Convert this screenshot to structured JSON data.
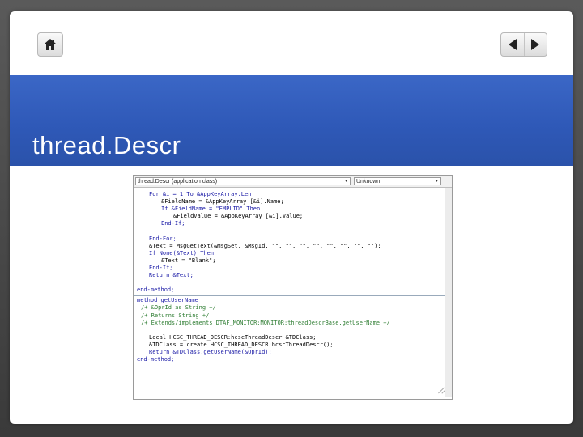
{
  "slide": {
    "title": "thread.Descr"
  },
  "icons": {
    "home": "home-icon",
    "prev": "triangle-left-icon",
    "next": "triangle-right-icon"
  },
  "colors": {
    "title_band": "#2f59b8",
    "title_text": "#ffffff",
    "keyword": "#1a1aa6",
    "comment": "#2e7d32",
    "string": "#b00020"
  },
  "code_editor": {
    "object_selector": "thread.Descr (application class)",
    "event_selector": "Unknown",
    "lines": [
      {
        "indent": 3,
        "text": "For &i = 1 To &AppKeyArray.Len",
        "kind": "kw"
      },
      {
        "indent": 6,
        "text": "&FieldName = &AppKeyArray [&i].Name;",
        "kind": "normal"
      },
      {
        "indent": 6,
        "text": "If &FieldName = \"EMPLID\" Then",
        "kind": "kw"
      },
      {
        "indent": 9,
        "text": "&FieldValue = &AppKeyArray [&i].Value;",
        "kind": "normal"
      },
      {
        "indent": 6,
        "text": "End-If;",
        "kind": "kw"
      },
      {
        "indent": 0,
        "text": "",
        "kind": "blank"
      },
      {
        "indent": 3,
        "text": "End-For;",
        "kind": "kw"
      },
      {
        "indent": 3,
        "text": "&Text = MsgGetText(&MsgSet, &MsgId, \"\", \"\", \"\", \"\", \"\", \"\", \"\", \"\");",
        "kind": "normal"
      },
      {
        "indent": 3,
        "text": "If None(&Text) Then",
        "kind": "kw"
      },
      {
        "indent": 6,
        "text": "&Text = \"Blank\";",
        "kind": "normal"
      },
      {
        "indent": 3,
        "text": "End-If;",
        "kind": "kw"
      },
      {
        "indent": 3,
        "text": "Return &Text;",
        "kind": "kw"
      },
      {
        "indent": 0,
        "text": "",
        "kind": "blank"
      },
      {
        "indent": 0,
        "text": "end-method;",
        "kind": "kw"
      },
      {
        "indent": 0,
        "text": "",
        "kind": "sep"
      },
      {
        "indent": 0,
        "text": "method getUserName",
        "kind": "kw"
      },
      {
        "indent": 1,
        "text": "/+ &OprId as String +/",
        "kind": "cm"
      },
      {
        "indent": 1,
        "text": "/+ Returns String +/",
        "kind": "cm"
      },
      {
        "indent": 1,
        "text": "/+ Extends/implements DTAF_MONITOR:MONITOR:threadDescrBase.getUserName +/",
        "kind": "cm"
      },
      {
        "indent": 0,
        "text": "",
        "kind": "blank"
      },
      {
        "indent": 3,
        "text": "Local HCSC_THREAD_DESCR:hcscThreadDescr &TDClass;",
        "kind": "normal"
      },
      {
        "indent": 3,
        "text": "&TDClass = create HCSC_THREAD_DESCR:hcscThreadDescr();",
        "kind": "normal"
      },
      {
        "indent": 3,
        "text": "Return &TDClass.getUserName(&OprId);",
        "kind": "kw"
      },
      {
        "indent": 0,
        "text": "end-method;",
        "kind": "kw"
      }
    ]
  }
}
